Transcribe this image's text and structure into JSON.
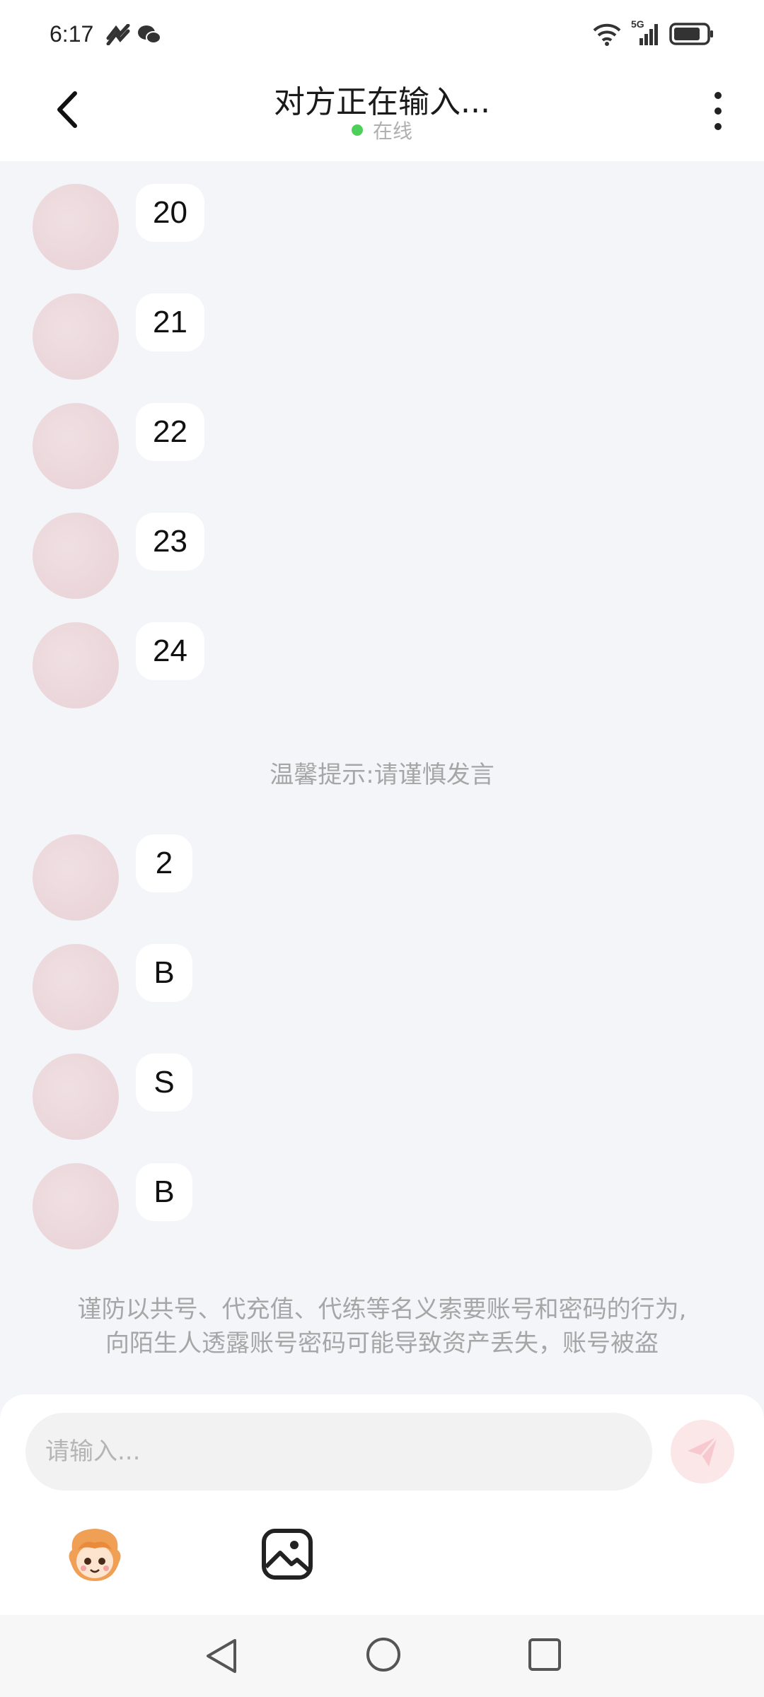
{
  "status_bar": {
    "time": "6:17",
    "network": "5G"
  },
  "header": {
    "title": "对方正在输入...",
    "status": "在线"
  },
  "messages_top": [
    {
      "text": "20"
    },
    {
      "text": "21"
    },
    {
      "text": "22"
    },
    {
      "text": "23"
    },
    {
      "text": "24"
    }
  ],
  "tip": "温馨提示:请谨慎发言",
  "messages_bottom": [
    {
      "text": "2"
    },
    {
      "text": "B"
    },
    {
      "text": "S"
    },
    {
      "text": "B"
    }
  ],
  "warning": {
    "line1": "谨防以共号、代充值、代练等名义索要账号和密码的行为,",
    "line2": "向陌生人透露账号密码可能导致资产丢失，账号被盗"
  },
  "composer": {
    "placeholder": "请输入..."
  },
  "colors": {
    "online": "#4cd05a",
    "send_bg": "#fbe6e8",
    "send_icon": "#f7c9ce",
    "avatar": "#eed9dc"
  },
  "icons": [
    "back-arrow-icon",
    "more-vertical-icon",
    "send-icon",
    "emoji-sticker-icon",
    "image-icon",
    "nav-back-icon",
    "nav-home-icon",
    "nav-recent-icon"
  ]
}
